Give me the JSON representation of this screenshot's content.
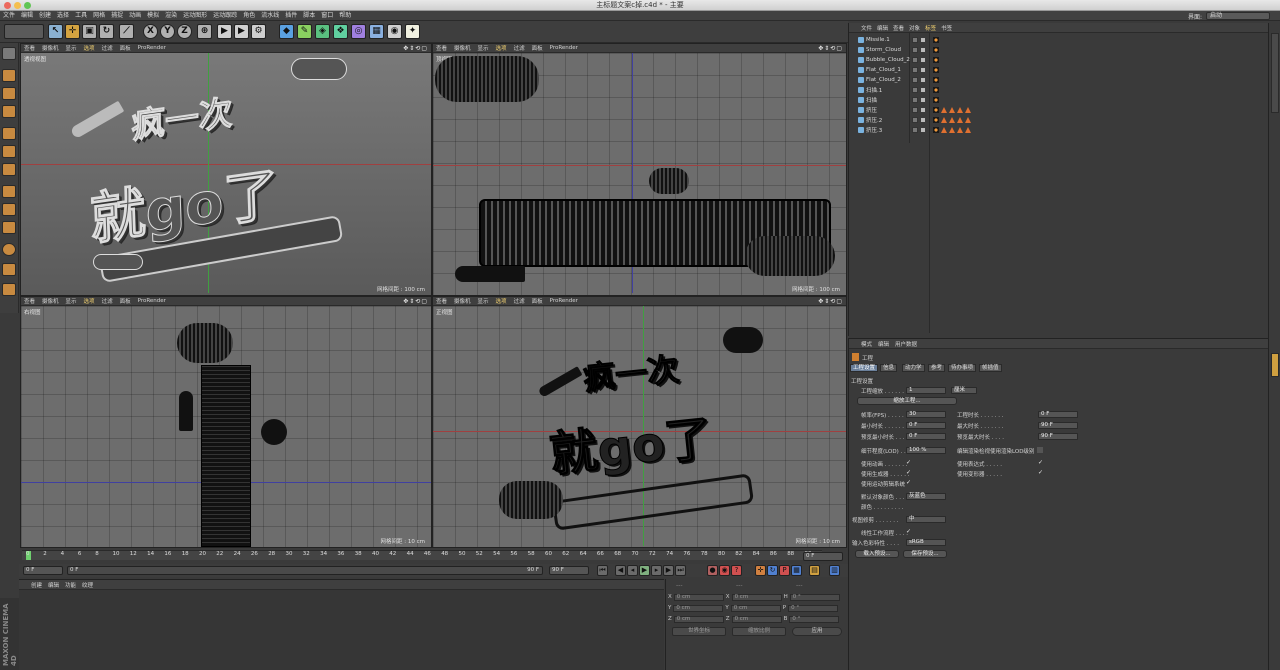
{
  "titlebar": {
    "title": "主标题文案c掉.c4d * - 主要"
  },
  "menu": [
    "文件",
    "编辑",
    "创建",
    "选择",
    "工具",
    "网格",
    "捕捉",
    "动画",
    "模拟",
    "渲染",
    "运动图形",
    "运动跟踪",
    "角色",
    "流水线",
    "插件",
    "脚本",
    "窗口",
    "帮助"
  ],
  "layout": {
    "label": "界面:",
    "value": "启动"
  },
  "viewports": [
    {
      "name": "透视视图",
      "menu": [
        "查看",
        "摄像机",
        "显示",
        "选项",
        "过滤",
        "面板",
        "ProRender"
      ],
      "active": "选项",
      "grid": "网格间距 : 100 cm"
    },
    {
      "name": "顶视图",
      "menu": [
        "查看",
        "摄像机",
        "显示",
        "选项",
        "过滤",
        "面板",
        "ProRender"
      ],
      "active": "选项",
      "grid": "网格间距 : 100 cm"
    },
    {
      "name": "右视图",
      "menu": [
        "查看",
        "摄像机",
        "显示",
        "选项",
        "过滤",
        "面板",
        "ProRender"
      ],
      "active": "选项",
      "grid": "网格间距 : 10 cm"
    },
    {
      "name": "正视图",
      "menu": [
        "查看",
        "摄像机",
        "显示",
        "选项",
        "过滤",
        "面板",
        "ProRender"
      ],
      "active": "选项",
      "grid": "网格间距 : 10 cm"
    }
  ],
  "scene_text": {
    "line1": "疯一次",
    "line2": "就go了"
  },
  "timeline": {
    "ticks": [
      "0",
      "2",
      "4",
      "6",
      "8",
      "10",
      "12",
      "14",
      "16",
      "18",
      "20",
      "22",
      "24",
      "26",
      "28",
      "30",
      "32",
      "34",
      "36",
      "38",
      "40",
      "42",
      "44",
      "46",
      "48",
      "50",
      "52",
      "54",
      "56",
      "58",
      "60",
      "62",
      "64",
      "66",
      "68",
      "70",
      "72",
      "74",
      "76",
      "78",
      "80",
      "82",
      "84",
      "86",
      "88",
      "90"
    ],
    "end_field": "0 F",
    "start": "0 F",
    "start2": "0 F",
    "end": "90 F",
    "end2": "90 F"
  },
  "material_tabs": [
    "创建",
    "编辑",
    "功能",
    "纹理"
  ],
  "coord": {
    "rows": [
      [
        "X",
        "0 cm",
        "X",
        "0 cm",
        "H",
        "0 °"
      ],
      [
        "Y",
        "0 cm",
        "Y",
        "0 cm",
        "P",
        "0 °"
      ],
      [
        "Z",
        "0 cm",
        "Z",
        "0 cm",
        "B",
        "0 °"
      ]
    ],
    "dd1": "世界坐标",
    "dd2": "缩放比例",
    "apply": "应用",
    "dashes": "---"
  },
  "objmgr": {
    "menu": [
      "文件",
      "编辑",
      "查看",
      "对象",
      "标签",
      "书签"
    ],
    "active": "标签",
    "objects": [
      {
        "name": "Missile.1",
        "tags": [
          "x"
        ]
      },
      {
        "name": "Storm_Cloud",
        "tags": [
          "x"
        ]
      },
      {
        "name": "Bubble_Cloud_2",
        "tags": [
          "x"
        ]
      },
      {
        "name": "Flat_Cloud_1",
        "tags": [
          "x"
        ]
      },
      {
        "name": "Flat_Cloud_2",
        "tags": [
          "x"
        ]
      },
      {
        "name": "扫描.1",
        "tags": [
          "x"
        ]
      },
      {
        "name": "扫描",
        "tags": [
          "x"
        ]
      },
      {
        "name": "挤压",
        "tags": [
          "x",
          "t",
          "t",
          "t",
          "t"
        ]
      },
      {
        "name": "挤压.2",
        "tags": [
          "x",
          "t",
          "t",
          "t",
          "t"
        ]
      },
      {
        "name": "挤压.3",
        "tags": [
          "x",
          "t",
          "t",
          "t",
          "t"
        ]
      }
    ]
  },
  "attr": {
    "menu": [
      "模式",
      "编辑",
      "用户数据"
    ],
    "title": "工程",
    "tabs": [
      "工程设置",
      "信息",
      "动力学",
      "参考",
      "待办事项",
      "帧插值"
    ],
    "section": "工程设置",
    "scale_label": "工程缩放 . . . . . . . .",
    "scale_val": "1",
    "scale_unit": "厘米",
    "scale_btn": "缩放工程...",
    "fps_l": "帧率(FPS) . . . . . . .",
    "fps_v": "30",
    "time_l": "工程时长 . . . . . . .",
    "time_v": "0 F",
    "min_l": "最小时长 . . . . . . .",
    "min_v": "0 F",
    "max_l": "最大时长 . . . . . . .",
    "max_v": "90 F",
    "pmin_l": "预览最小时长 . . . .",
    "pmin_v": "0 F",
    "pmax_l": "预览最大时长 . . . .",
    "pmax_v": "90 F",
    "lod_l": "细节程度(LOD) . . . .",
    "lod_v": "100 %",
    "lod2_l": "编辑渲染检视使用渲染LOD级别",
    "anim_l": "使用动画 . . . . . . .",
    "expr_l": "使用表达式 . . . . .",
    "gen_l": "使用生成器 . . . . . .",
    "def_l": "使用变形器 . . . . .",
    "mo_l": "使用运动剪辑系统",
    "col_l": "默认对象颜色 . . . .",
    "col_v": "灰蓝色",
    "color_l": "颜色 . . . . . . . . .",
    "view_l": "视图修剪 . . . . . . .",
    "view_v": "中",
    "lin_l": "线性工作流程 . . . .",
    "inp_l": "输入色彩特性 . . . .",
    "inp_v": "sRGB",
    "load_btn": "载入预设...",
    "save_btn": "保存预设...",
    "check": "✓"
  },
  "logo": {
    "line1": "MAXON",
    "line2": "CINEMA 4D"
  }
}
